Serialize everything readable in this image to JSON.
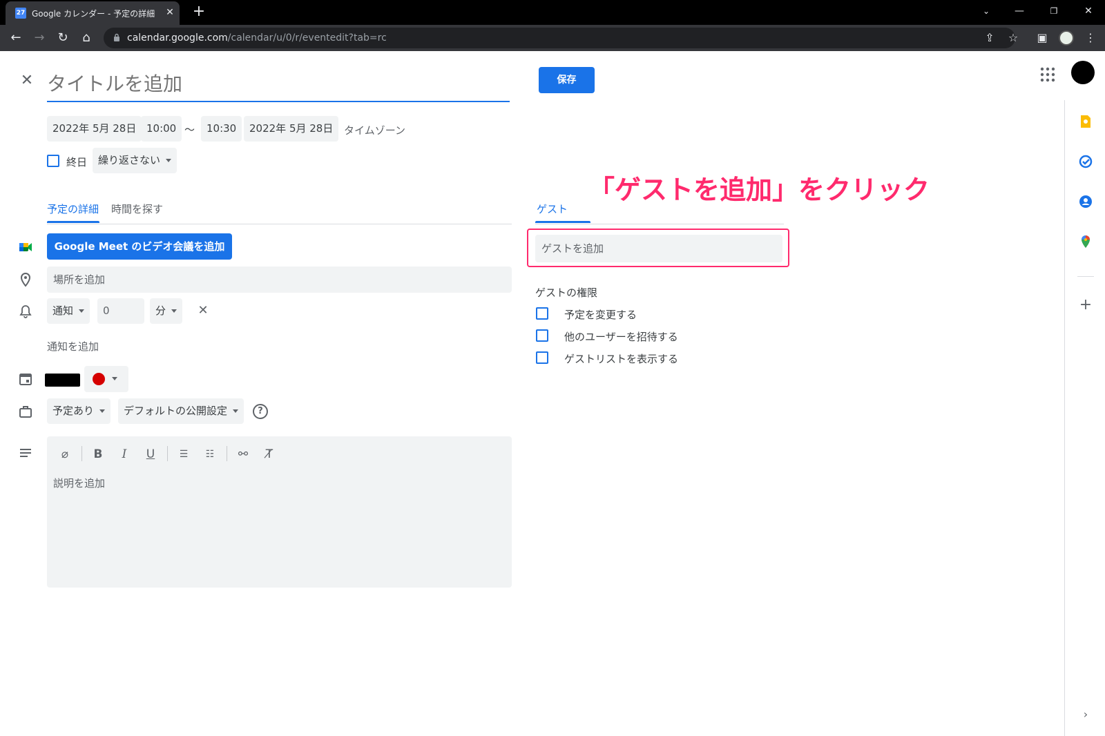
{
  "browser": {
    "tab_title": "Google カレンダー - 予定の詳細",
    "favicon_text": "27",
    "url_host": "calendar.google.com",
    "url_path": "/calendar/u/0/r/eventedit?tab=rc"
  },
  "event": {
    "title_placeholder": "タイトルを追加",
    "save_label": "保存",
    "start_date": "2022年 5月 28日",
    "start_time": "10:00",
    "range_separator": "〜",
    "end_time": "10:30",
    "end_date": "2022年 5月 28日",
    "timezone_label": "タイムゾーン",
    "all_day_label": "終日",
    "repeat_value": "繰り返さない"
  },
  "tabs": {
    "details_label": "予定の詳細",
    "find_time_label": "時間を探す",
    "guests_label": "ゲスト"
  },
  "details": {
    "meet_button_label": "Google Meet のビデオ会議を追加",
    "location_placeholder": "場所を追加",
    "notification_type": "通知",
    "notification_value": "0",
    "notification_unit": "分",
    "add_notification_label": "通知を追加",
    "busy_status": "予定あり",
    "visibility": "デフォルトの公開設定",
    "description_placeholder": "説明を追加",
    "event_color": "#d50000"
  },
  "guests": {
    "add_guest_placeholder": "ゲストを追加",
    "permissions_title": "ゲストの権限",
    "permissions": [
      {
        "label": "予定を変更する",
        "checked": false
      },
      {
        "label": "他のユーザーを招待する",
        "checked": false
      },
      {
        "label": "ゲストリストを表示する",
        "checked": false
      }
    ]
  },
  "annotation": {
    "text": "「ゲストを追加」をクリック",
    "color": "#ff2a6d"
  },
  "colors": {
    "accent": "#1a73e8",
    "chrome_dark": "#35363a",
    "field_bg": "#f1f3f4"
  }
}
